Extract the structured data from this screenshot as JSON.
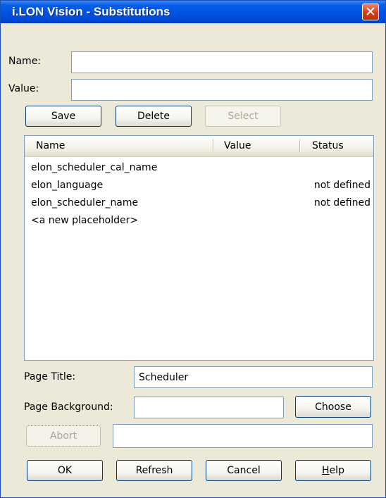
{
  "window": {
    "title": "i.LON Vision - Substitutions",
    "close_glyph": "✕"
  },
  "form": {
    "name_label": "Name:",
    "name_value": "",
    "value_label": "Value:",
    "value_value": ""
  },
  "buttons": {
    "save": "Save",
    "delete": "Delete",
    "select": "Select",
    "choose": "Choose",
    "abort": "Abort",
    "ok": "OK",
    "refresh": "Refresh",
    "cancel": "Cancel",
    "help_mnemonic": "H",
    "help_rest": "elp"
  },
  "list": {
    "columns": [
      "Name",
      "Value",
      "Status"
    ],
    "rows": [
      {
        "name": "elon_scheduler_cal_name",
        "value": "",
        "status": ""
      },
      {
        "name": "elon_language",
        "value": "",
        "status": "not defined"
      },
      {
        "name": "elon_scheduler_name",
        "value": "",
        "status": "not defined"
      },
      {
        "name": "<a new placeholder>",
        "value": "",
        "status": ""
      }
    ]
  },
  "page": {
    "title_label": "Page Title:",
    "title_value": "Scheduler",
    "background_label": "Page Background:",
    "background_value": "",
    "status_value": ""
  },
  "colors": {
    "titlebar": "#0054e3",
    "dialog_bg": "#ece9d8",
    "close_button": "#d43e1a",
    "button_border": "#003c74"
  }
}
